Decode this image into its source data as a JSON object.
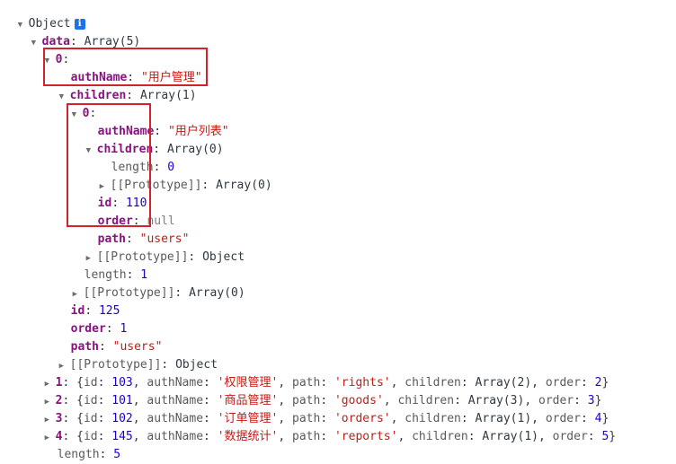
{
  "root": {
    "label": "Object",
    "info_icon": "i"
  },
  "data_line": {
    "key": "data",
    "value": "Array(5)"
  },
  "item0": {
    "index": "0",
    "authName_key": "authName",
    "authName_value": "\"用户管理\"",
    "children_key": "children",
    "children_value": "Array(1)",
    "child0": {
      "index": "0",
      "authName_key": "authName",
      "authName_value": "\"用户列表\"",
      "children_key": "children",
      "children_value": "Array(0)",
      "length_key": "length",
      "length_value": "0",
      "proto_key": "[[Prototype]]",
      "proto_value": "Array(0)",
      "id_key": "id",
      "id_value": "110",
      "order_key": "order",
      "order_value": "null",
      "path_key": "path",
      "path_value": "\"users\"",
      "obj_proto_key": "[[Prototype]]",
      "obj_proto_value": "Object"
    },
    "children_length_key": "length",
    "children_length_value": "1",
    "children_proto_key": "[[Prototype]]",
    "children_proto_value": "Array(0)",
    "id_key": "id",
    "id_value": "125",
    "order_key": "order",
    "order_value": "1",
    "path_key": "path",
    "path_value": "\"users\"",
    "proto_key": "[[Prototype]]",
    "proto_value": "Object"
  },
  "collapsed_items": [
    {
      "index": "1",
      "id": "103",
      "authName": "'权限管理'",
      "path": "'rights'",
      "children": "Array(2)",
      "order": "2"
    },
    {
      "index": "2",
      "id": "101",
      "authName": "'商品管理'",
      "path": "'goods'",
      "children": "Array(3)",
      "order": "3"
    },
    {
      "index": "3",
      "id": "102",
      "authName": "'订单管理'",
      "path": "'orders'",
      "children": "Array(1)",
      "order": "4"
    },
    {
      "index": "4",
      "id": "145",
      "authName": "'数据统计'",
      "path": "'reports'",
      "children": "Array(1)",
      "order": "5"
    }
  ],
  "labels": {
    "id": "id",
    "authName": "authName",
    "path": "path",
    "children": "children",
    "order": "order"
  },
  "data_length": {
    "key": "length",
    "value": "5"
  },
  "colors": {
    "highlight_box": "#d0242c",
    "key": "#881280",
    "string": "#c41a16",
    "number": "#1c00cf",
    "info_icon": "#1a73e8"
  }
}
